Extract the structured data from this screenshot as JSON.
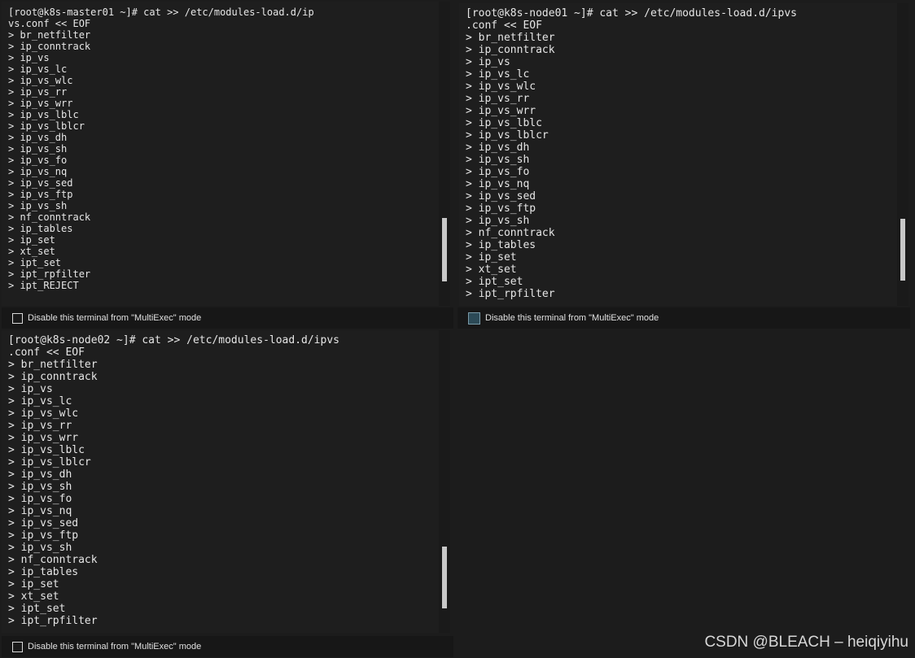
{
  "panes": {
    "master01": {
      "lines": [
        "[root@k8s-master01 ~]# cat >> /etc/modules-load.d/ip",
        "vs.conf << EOF",
        "> br_netfilter",
        "> ip_conntrack",
        "> ip_vs",
        "> ip_vs_lc",
        "> ip_vs_wlc",
        "> ip_vs_rr",
        "> ip_vs_wrr",
        "> ip_vs_lblc",
        "> ip_vs_lblcr",
        "> ip_vs_dh",
        "> ip_vs_sh",
        "> ip_vs_fo",
        "> ip_vs_nq",
        "> ip_vs_sed",
        "> ip_vs_ftp",
        "> ip_vs_sh",
        "> nf_conntrack",
        "> ip_tables",
        "> ip_set",
        "> xt_set",
        "> ipt_set",
        "> ipt_rpfilter",
        "> ipt_REJECT"
      ],
      "multiexec_label": "Disable this terminal from \"MultiExec\" mode",
      "multiexec_checked": false
    },
    "node01": {
      "lines": [
        "[root@k8s-node01 ~]# cat >> /etc/modules-load.d/ipvs",
        ".conf << EOF",
        "> br_netfilter",
        "> ip_conntrack",
        "> ip_vs",
        "> ip_vs_lc",
        "> ip_vs_wlc",
        "> ip_vs_rr",
        "> ip_vs_wrr",
        "> ip_vs_lblc",
        "> ip_vs_lblcr",
        "> ip_vs_dh",
        "> ip_vs_sh",
        "> ip_vs_fo",
        "> ip_vs_nq",
        "> ip_vs_sed",
        "> ip_vs_ftp",
        "> ip_vs_sh",
        "> nf_conntrack",
        "> ip_tables",
        "> ip_set",
        "> xt_set",
        "> ipt_set",
        "> ipt_rpfilter"
      ],
      "multiexec_label": "Disable this terminal from \"MultiExec\" mode",
      "multiexec_checked": false
    },
    "node02": {
      "lines": [
        "[root@k8s-node02 ~]# cat >> /etc/modules-load.d/ipvs",
        ".conf << EOF",
        "> br_netfilter",
        "> ip_conntrack",
        "> ip_vs",
        "> ip_vs_lc",
        "> ip_vs_wlc",
        "> ip_vs_rr",
        "> ip_vs_wrr",
        "> ip_vs_lblc",
        "> ip_vs_lblcr",
        "> ip_vs_dh",
        "> ip_vs_sh",
        "> ip_vs_fo",
        "> ip_vs_nq",
        "> ip_vs_sed",
        "> ip_vs_ftp",
        "> ip_vs_sh",
        "> nf_conntrack",
        "> ip_tables",
        "> ip_set",
        "> xt_set",
        "> ipt_set",
        "> ipt_rpfilter"
      ],
      "multiexec_label": "Disable this terminal from \"MultiExec\" mode",
      "multiexec_checked": false
    }
  },
  "watermark": "CSDN @BLEACH – heiqiyihu",
  "colors": {
    "terminal_bg": "#1e1e1e",
    "terminal_fg": "#e6e6e6",
    "footer_bg": "#171717",
    "scroll_thumb": "#c8c8c8"
  }
}
